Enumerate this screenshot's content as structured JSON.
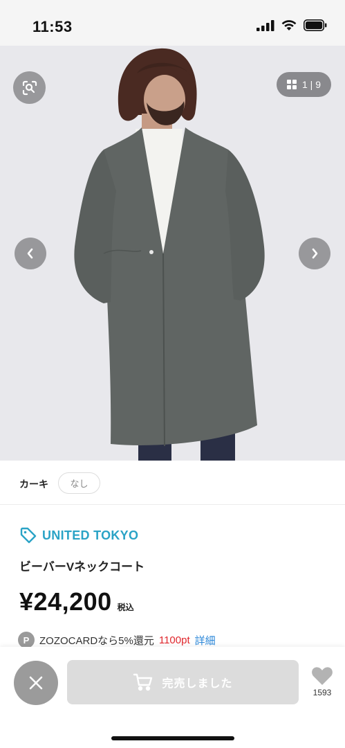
{
  "status_bar": {
    "time": "11:53"
  },
  "gallery": {
    "counter": "1 | 9"
  },
  "color": {
    "name": "カーキ",
    "size_option": "なし"
  },
  "product": {
    "brand": "UNITED TOKYO",
    "name": "ビーバーVネックコート",
    "price": "¥24,200",
    "tax_label": "税込"
  },
  "points": {
    "badge": "P",
    "text": "ZOZOCARDなら5%還元",
    "amount": "1100pt",
    "link": "詳細"
  },
  "actions": {
    "sold_out_label": "完売しました",
    "favorite_count": "1593"
  },
  "colors": {
    "brand": "#2aa3c6",
    "points_red": "#e0262c",
    "link_blue": "#2a86d8",
    "coat": "#5f6462"
  }
}
